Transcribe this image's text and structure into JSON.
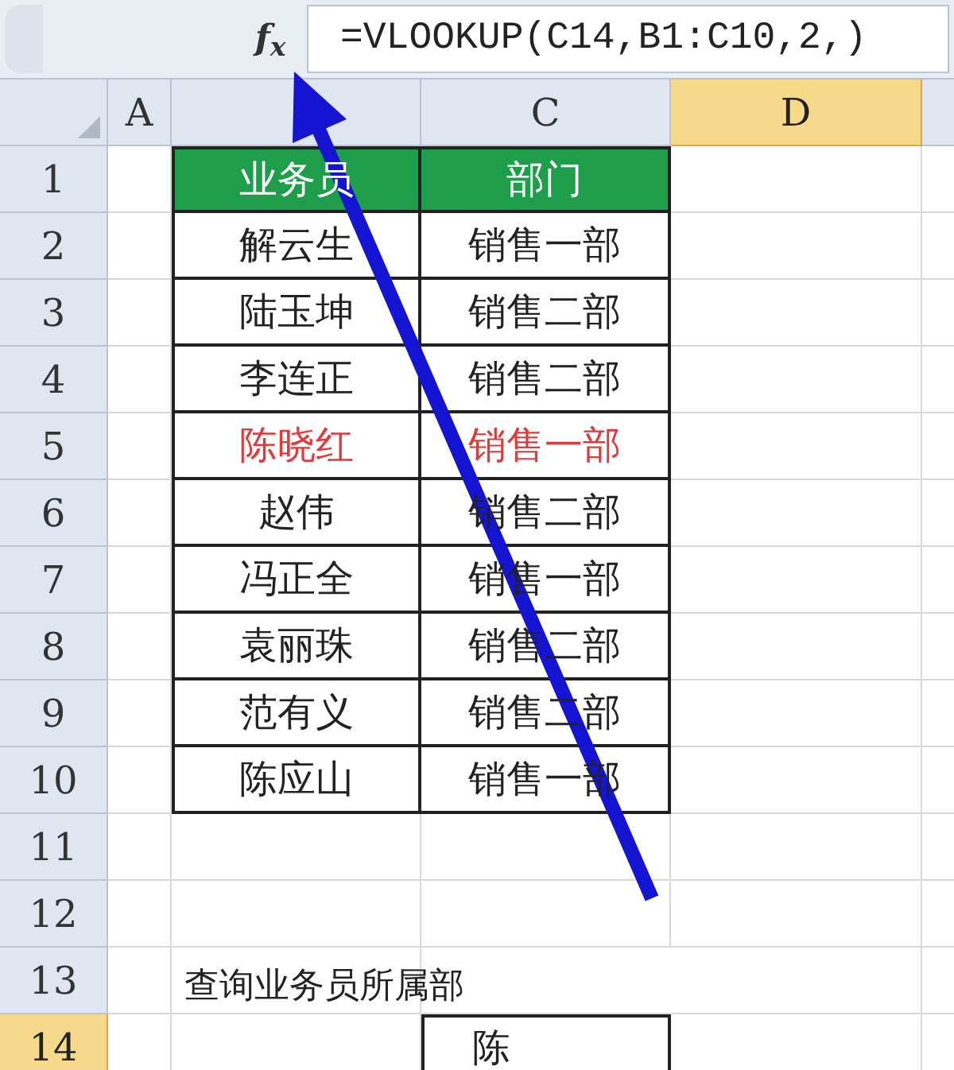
{
  "formula_bar": {
    "fx": "f$_{x}$",
    "formula": "=VLOOKUP(C14,B1:C10,2,)"
  },
  "column_headers": [
    {
      "label": "A",
      "selected": false
    },
    {
      "selected": false
    },
    {
      "label": "C",
      "selected": false
    },
    {
      "label": "D",
      "selected": true
    }
  ],
  "row_headers": [
    {
      "label": "1",
      "selected": false
    },
    {
      "label": "2",
      "selected": false
    },
    {
      "label": "3",
      "selected": false
    },
    {
      "label": "4",
      "selected": false
    },
    {
      "label": "5",
      "selected": false
    },
    {
      "label": "6",
      "selected": false
    },
    {
      "label": "7",
      "selected": false
    },
    {
      "label": "8",
      "selected": false
    },
    {
      "label": "9",
      "selected": false
    },
    {
      "label": "10",
      "selected": false
    },
    {
      "label": "11",
      "selected": false
    },
    {
      "label": "12",
      "selected": false
    },
    {
      "label": "13",
      "selected": false
    },
    {
      "label": "14",
      "selected": true
    }
  ],
  "table": {
    "columns": [
      "业务员",
      "部门"
    ],
    "rows": [
      {
        "name": "解云生",
        "department": "销售一部",
        "highlighted": false
      },
      {
        "name": "陆玉坤",
        "department": "销售二部",
        "highlighted": false
      },
      {
        "name": "李连正",
        "department": "销售二部",
        "highlighted": false
      },
      {
        "name": "陈晓红",
        "department": "销售一部",
        "highlighted": true
      },
      {
        "name": "赵伟",
        "department": "销售二部",
        "highlighted": false
      },
      {
        "name": "冯正全",
        "department": "销售一部",
        "highlighted": false
      },
      {
        "name": "袁丽珠",
        "department": "销售二部",
        "highlighted": false
      },
      {
        "name": "范有义",
        "department": "销售二部",
        "highlighted": false
      },
      {
        "name": "陈应山",
        "department": "销售一部",
        "highlighted": false
      }
    ]
  },
  "query": {
    "label": "查询业务员所属部",
    "value": "陈"
  }
}
